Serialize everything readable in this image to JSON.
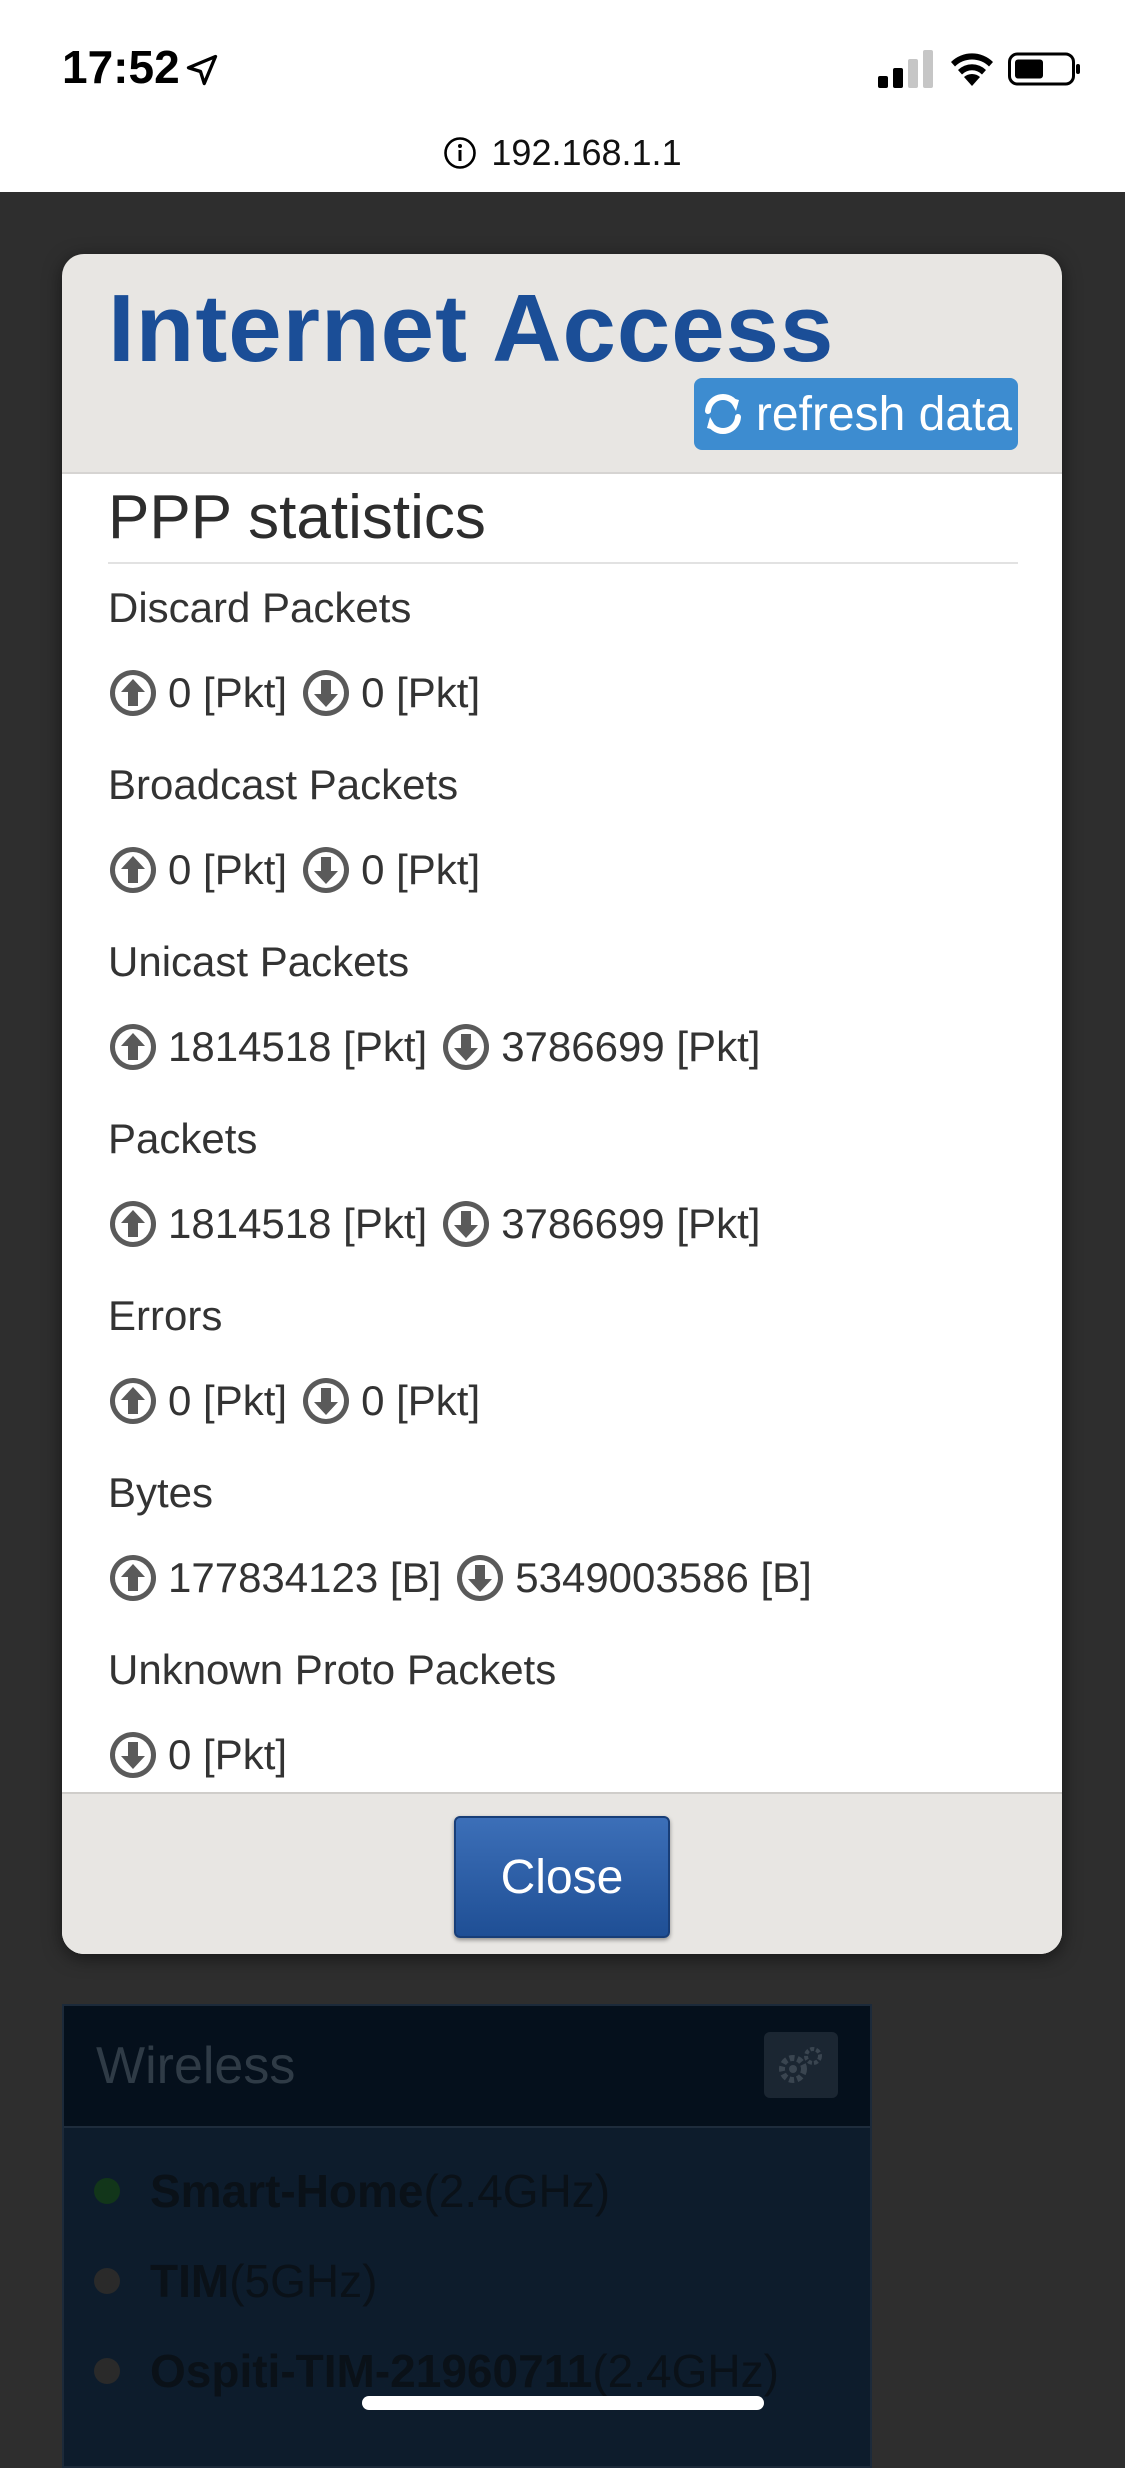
{
  "status_bar": {
    "time": "17:52",
    "url": "192.168.1.1"
  },
  "modal": {
    "title": "Internet Access",
    "refresh_label": "refresh data",
    "section_title": "PPP statistics",
    "stats": [
      {
        "label": "Discard Packets",
        "up": "0 [Pkt]",
        "down": "0 [Pkt]"
      },
      {
        "label": "Broadcast Packets",
        "up": "0 [Pkt]",
        "down": "0 [Pkt]"
      },
      {
        "label": "Unicast Packets",
        "up": "1814518 [Pkt]",
        "down": "3786699 [Pkt]"
      },
      {
        "label": "Packets",
        "up": "1814518 [Pkt]",
        "down": "3786699 [Pkt]"
      },
      {
        "label": "Errors",
        "up": "0 [Pkt]",
        "down": "0 [Pkt]"
      },
      {
        "label": "Bytes",
        "up": "177834123 [B]",
        "down": "5349003586 [B]"
      },
      {
        "label": "Unknown Proto Packets",
        "down": "0 [Pkt]"
      }
    ],
    "close_label": "Close"
  },
  "background": {
    "wireless_title": "Wireless",
    "networks": [
      {
        "name": "Smart-Home",
        "band": "(2.4GHz)",
        "status_color": "#12361a"
      },
      {
        "name": "TIM",
        "band": "(5GHz)",
        "status_color": "#2a2a2a"
      },
      {
        "name": "Ospiti-TIM-21960711",
        "band": "(2.4GHz)",
        "status_color": "#2a2a2a"
      }
    ]
  },
  "colors": {
    "title_blue": "#1b4e97",
    "refresh_blue": "#3d8cd0",
    "close_blue": "#2a5ca4"
  }
}
